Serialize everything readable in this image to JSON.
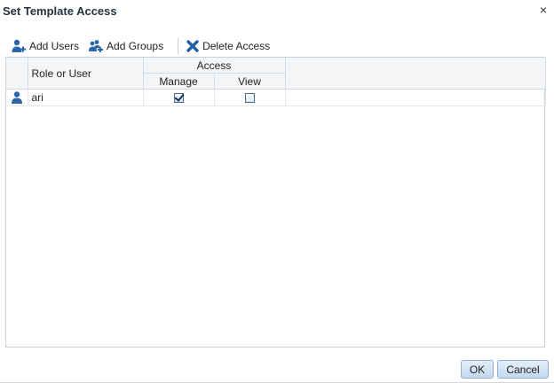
{
  "dialog": {
    "title": "Set Template Access",
    "close_symbol": "×"
  },
  "toolbar": {
    "add_users_label": "Add Users",
    "add_users_icon": "add-user-icon",
    "add_groups_label": "Add Groups",
    "add_groups_icon": "add-group-icon",
    "delete_access_label": "Delete Access",
    "delete_access_icon": "delete-x-icon"
  },
  "table": {
    "col_role": "Role or User",
    "col_access_group": "Access",
    "col_manage": "Manage",
    "col_view": "View",
    "rows": [
      {
        "icon": "user-icon",
        "name": "ari",
        "manage": true,
        "view": false
      }
    ]
  },
  "footer": {
    "ok_label": "OK",
    "cancel_label": "Cancel"
  },
  "colors": {
    "icon_blue": "#2a66a8",
    "delete_blue": "#1f5fa3",
    "header_bg": "#f3f5f7"
  }
}
